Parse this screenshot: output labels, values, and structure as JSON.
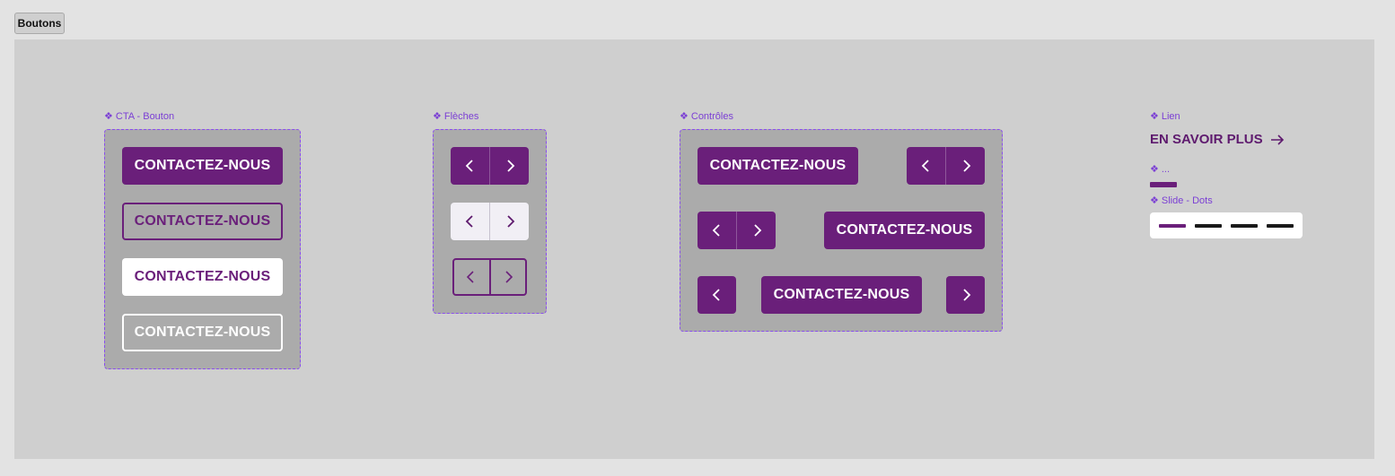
{
  "frame": {
    "label": "Boutons"
  },
  "cta_button": {
    "label": "CTA - Bouton",
    "variants": [
      "CONTACTEZ-NOUS",
      "CONTACTEZ-NOUS",
      "CONTACTEZ-NOUS",
      "CONTACTEZ-NOUS"
    ]
  },
  "arrows": {
    "label": "Flèches"
  },
  "controls": {
    "label": "Contrôles",
    "row1_button": "CONTACTEZ-NOUS",
    "row2_button": "CONTACTEZ-NOUS",
    "row3_button": "CONTACTEZ-NOUS"
  },
  "link": {
    "label": "Lien",
    "text": "EN SAVOIR PLUS",
    "arrow_icon": "arrow-right-icon"
  },
  "line": {
    "label": "..."
  },
  "slide_dots": {
    "label": "Slide - Dots",
    "count": 4,
    "active_index": 0
  },
  "component_glyph": "❖",
  "colors": {
    "primary": "#6a1f7a",
    "component_accent": "#8a4cf0",
    "canvas": "#cfcfcf",
    "box_bg": "#ababab"
  }
}
